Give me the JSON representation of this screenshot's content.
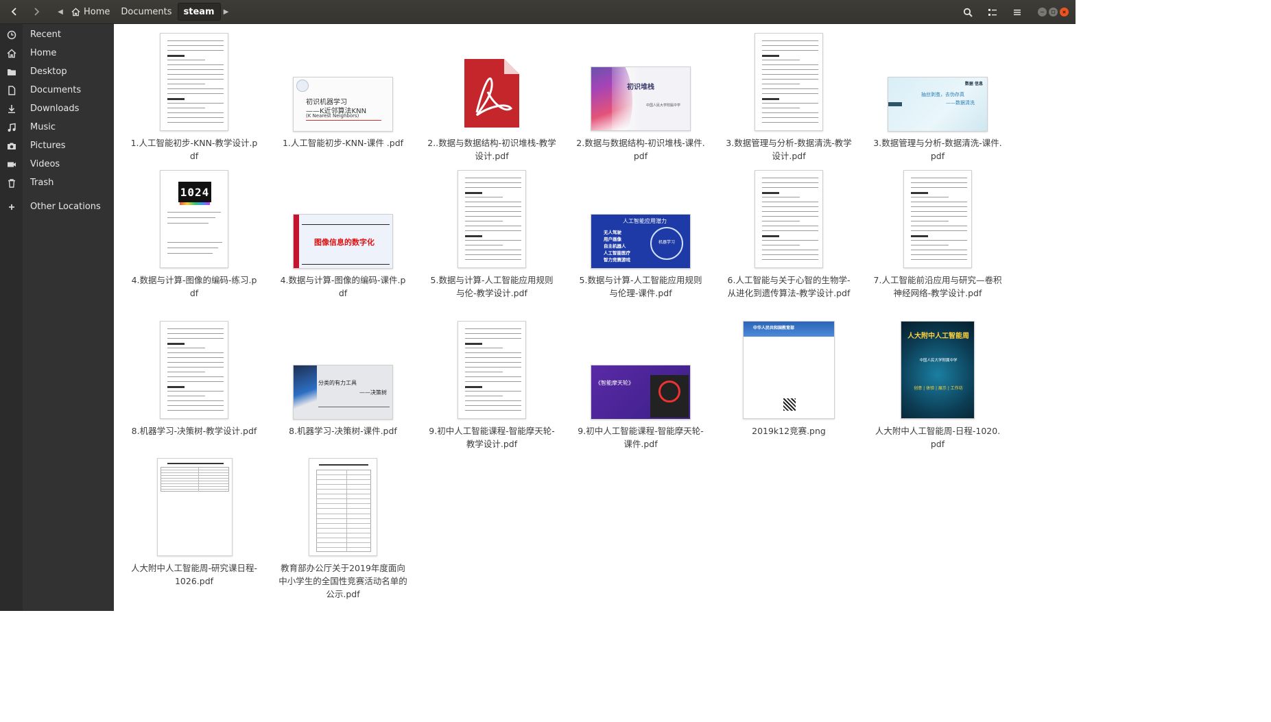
{
  "breadcrumb": [
    "Home",
    "Documents",
    "steam"
  ],
  "sidebar": {
    "places": [
      {
        "label": "Recent",
        "icon": "clock-icon"
      },
      {
        "label": "Home",
        "icon": "home-icon"
      },
      {
        "label": "Desktop",
        "icon": "folder-icon"
      },
      {
        "label": "Documents",
        "icon": "document-icon"
      },
      {
        "label": "Downloads",
        "icon": "download-icon"
      },
      {
        "label": "Music",
        "icon": "music-icon"
      },
      {
        "label": "Pictures",
        "icon": "camera-icon"
      },
      {
        "label": "Videos",
        "icon": "video-icon"
      },
      {
        "label": "Trash",
        "icon": "trash-icon"
      }
    ],
    "other": {
      "label": "Other Locations",
      "icon": "plus-icon"
    }
  },
  "files": [
    {
      "name": "1.人工智能初步-KNN-教学设计.pdf",
      "kind": "doc"
    },
    {
      "name": "1.人工智能初步-KNN-课件 .pdf",
      "kind": "slide-knn"
    },
    {
      "name": "2..数据与数据结构-初识堆栈-教学设计.pdf",
      "kind": "pdf-icon"
    },
    {
      "name": "2.数据与数据结构-初识堆栈-课件.pdf",
      "kind": "slide-stack"
    },
    {
      "name": "3.数据管理与分析-数据清洗-教学设计.pdf",
      "kind": "doc"
    },
    {
      "name": "3.数据管理与分析-数据清洗-课件.pdf",
      "kind": "slide-clean"
    },
    {
      "name": "4.数据与计算-图像的编码-练习.pdf",
      "kind": "doc-1024"
    },
    {
      "name": "4.数据与计算-图像的编码-课件.pdf",
      "kind": "slide-image"
    },
    {
      "name": "5.数据与计算-人工智能应用规则与伦-教学设计.pdf",
      "kind": "doc"
    },
    {
      "name": "5.数据与计算-人工智能应用规则与伦理-课件.pdf",
      "kind": "slide-ai"
    },
    {
      "name": "6.人工智能与关于心智的生物学-从进化到遗传算法-教学设计.pdf",
      "kind": "doc"
    },
    {
      "name": "7.人工智能前沿应用与研究—卷积神经网络-教学设计.pdf",
      "kind": "doc"
    },
    {
      "name": "8.机器学习-决策树-教学设计.pdf",
      "kind": "doc"
    },
    {
      "name": "8.机器学习-决策树-课件.pdf",
      "kind": "slide-tree"
    },
    {
      "name": "9.初中人工智能课程-智能摩天轮-教学设计.pdf",
      "kind": "doc"
    },
    {
      "name": "9.初中人工智能课程-智能摩天轮-课件.pdf",
      "kind": "slide-wheel"
    },
    {
      "name": "2019k12竞赛.png",
      "kind": "png-web"
    },
    {
      "name": "人大附中人工智能周-日程-1020.pdf",
      "kind": "poster"
    },
    {
      "name": "人大附中人工智能周-研究课日程-1026.pdf",
      "kind": "doc-table-wide"
    },
    {
      "name": "教育部办公厅关于2019年度面向中小学生的全国性竞赛活动名单的公示.pdf",
      "kind": "doc-table"
    }
  ],
  "thumb_text": {
    "knn_title": "初识机器学习",
    "knn_sub": "——K近邻算法KNN",
    "knn_en": "(K Nearest Neighbors)",
    "stack_title": "初识堆栈",
    "stack_org": "中国人民大学附属中学",
    "clean_title": "数据 信息",
    "clean_line1": "抽丝剥茧，去伪存真",
    "clean_line2": "——数据清洗",
    "image_title": "图像信息的数字化",
    "ai_title": "人工智能应用潜力",
    "ai_items": [
      "无人驾驶",
      "用户画像",
      "自主机器人",
      "人工智能医疗",
      "智力竞赛游戏"
    ],
    "ai_center": "机器学习",
    "tree_title": "分类的有力工具",
    "tree_sub": "——决策树",
    "wheel_title": "《智能摩天轮》",
    "web_header": "中华人民共和国教育部",
    "poster_title": "人大附中人工智能周",
    "poster_school": "中国人民大学附属中学",
    "poster_tags": "创意 | 体验 | 展示 | 工作坊",
    "code_1024": "1024"
  }
}
